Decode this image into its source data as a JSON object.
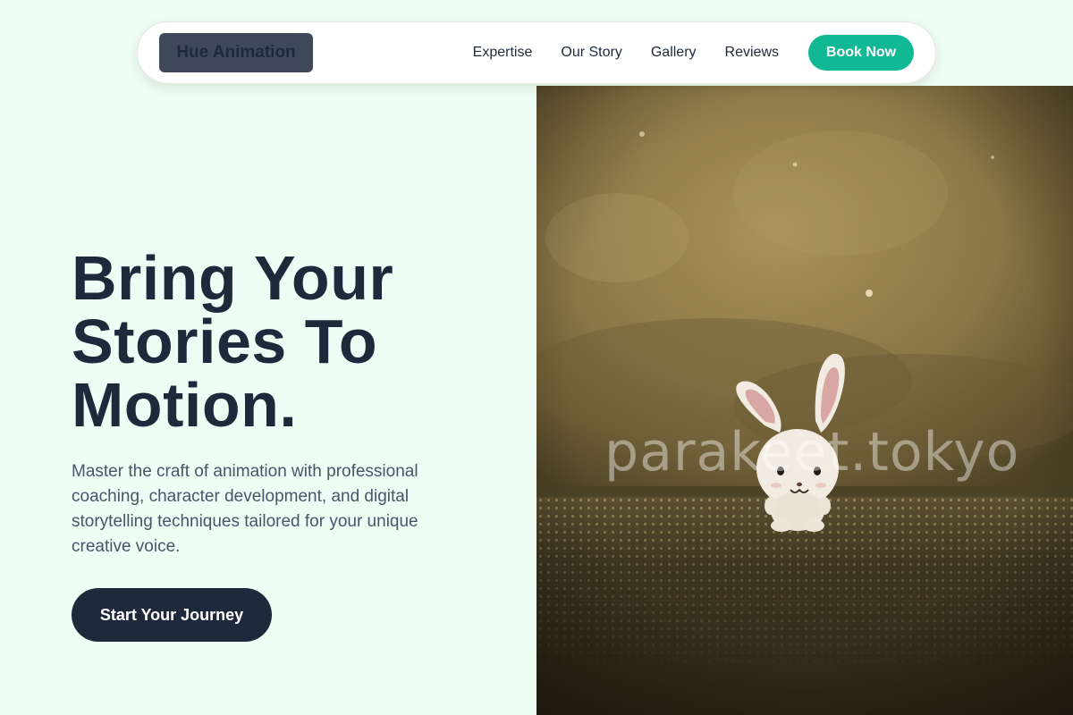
{
  "brand": {
    "name": "Hue Animation"
  },
  "nav": {
    "links": [
      "Expertise",
      "Our Story",
      "Gallery",
      "Reviews"
    ],
    "cta_label": "Book Now"
  },
  "hero": {
    "title_lines": [
      "Bring Your",
      "Stories To",
      "Motion."
    ],
    "description": "Master the craft of animation with professional coaching, character development, and digital storytelling techniques tailored for your unique creative voice.",
    "cta_label": "Start Your Journey",
    "image": {
      "watermark": "parakeet.tokyo"
    }
  },
  "colors": {
    "page_background": "#effef4",
    "accent": "#10b894",
    "dark": "#1e293b",
    "logo_background": "#3f4859"
  }
}
